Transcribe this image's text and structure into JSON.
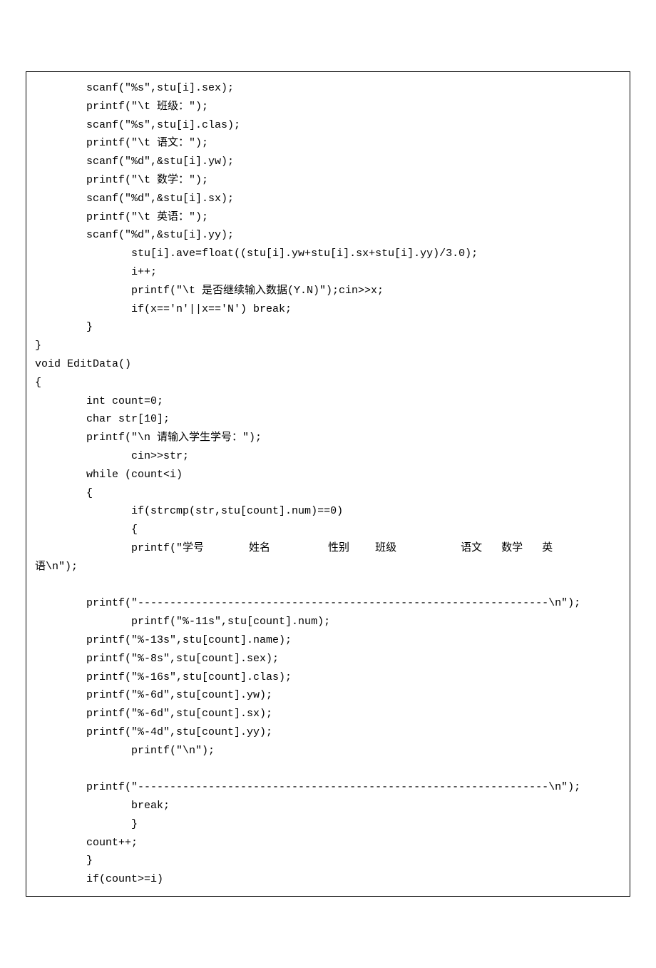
{
  "code": {
    "lines": [
      "        scanf(\"%s\",stu[i].sex);",
      "        printf(\"\\t 班级：\");",
      "        scanf(\"%s\",stu[i].clas);",
      "        printf(\"\\t 语文：\");",
      "        scanf(\"%d\",&stu[i].yw);",
      "        printf(\"\\t 数学：\");",
      "        scanf(\"%d\",&stu[i].sx);",
      "        printf(\"\\t 英语：\");",
      "        scanf(\"%d\",&stu[i].yy);",
      "               stu[i].ave=float((stu[i].yw+stu[i].sx+stu[i].yy)/3.0);",
      "               i++;",
      "               printf(\"\\t 是否继续输入数据(Y.N)\");cin>>x;",
      "               if(x=='n'||x=='N') break;",
      "        }",
      "}",
      "void EditData()",
      "{",
      "        int count=0;",
      "        char str[10];",
      "        printf(\"\\n 请输入学生学号：\");",
      "               cin>>str;",
      "        while (count<i)",
      "        {",
      "               if(strcmp(str,stu[count].num)==0)",
      "               {",
      "               printf(\"学号       姓名         性别    班级          语文   数学   英",
      "语\\n\");",
      "",
      "        printf(\"----------------------------------------------------------------\\n\");",
      "               printf(\"%-11s\",stu[count].num);",
      "        printf(\"%-13s\",stu[count].name);",
      "        printf(\"%-8s\",stu[count].sex);",
      "        printf(\"%-16s\",stu[count].clas);",
      "        printf(\"%-6d\",stu[count].yw);",
      "        printf(\"%-6d\",stu[count].sx);",
      "        printf(\"%-4d\",stu[count].yy);",
      "               printf(\"\\n\");",
      "",
      "        printf(\"----------------------------------------------------------------\\n\");",
      "               break;",
      "               }",
      "        count++;",
      "        }",
      "        if(count>=i)"
    ]
  }
}
